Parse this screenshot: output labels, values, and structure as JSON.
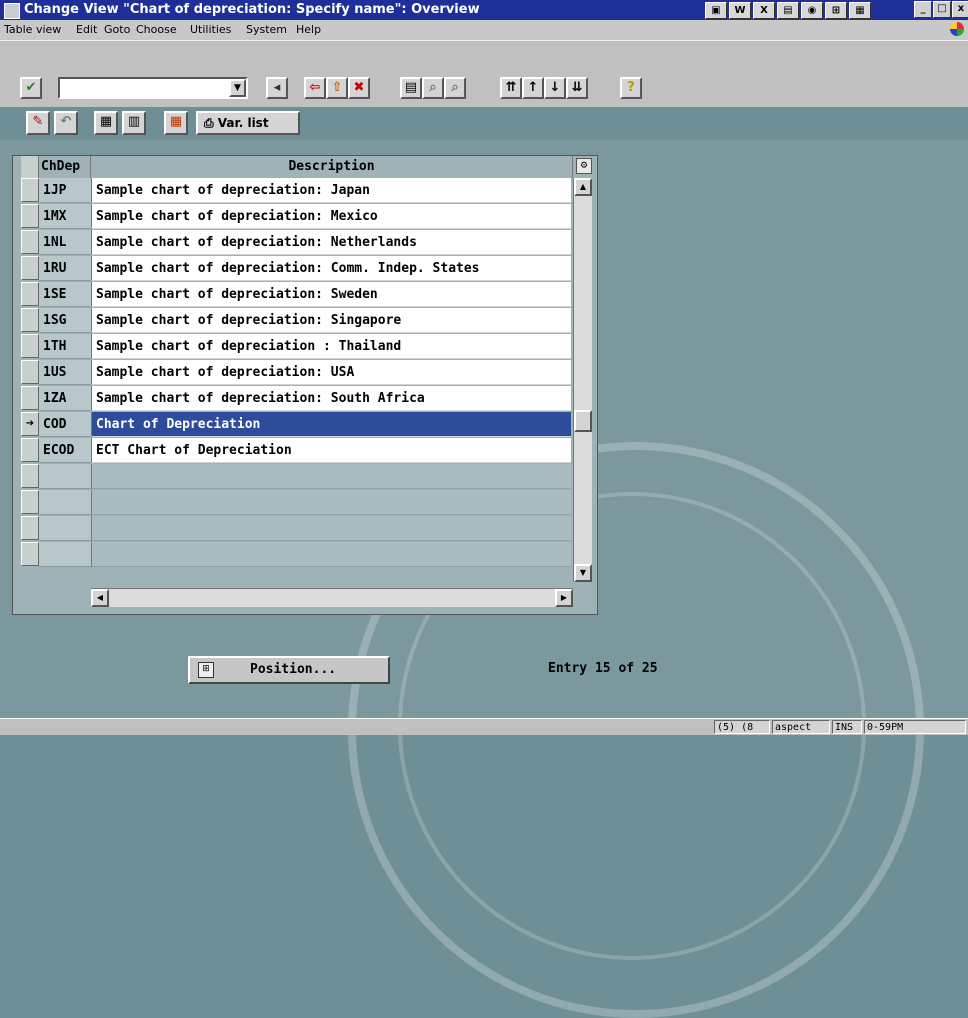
{
  "window": {
    "title": "Change View \"Chart of depreciation: Specify name\": Overview",
    "controls": [
      "_",
      "□",
      "x"
    ]
  },
  "title_tools": [
    "▣",
    "W",
    "X",
    "▤",
    "◉",
    "⊞",
    "▦"
  ],
  "menu": [
    {
      "label": "Table view"
    },
    {
      "label": "Edit"
    },
    {
      "label": "Goto"
    },
    {
      "label": "Choose"
    },
    {
      "label": "Utilities"
    },
    {
      "label": "System"
    },
    {
      "label": "Help"
    }
  ],
  "toolbar": {
    "command_field_value": "",
    "var_list_label": "Var. list",
    "help_label": "?"
  },
  "table": {
    "columns": [
      "ChDep",
      "Description"
    ],
    "rows": [
      {
        "key": "1JP",
        "desc": "Sample chart of depreciation: Japan"
      },
      {
        "key": "1MX",
        "desc": "Sample chart of depreciation: Mexico"
      },
      {
        "key": "1NL",
        "desc": "Sample chart of depreciation: Netherlands"
      },
      {
        "key": "1RU",
        "desc": "Sample chart of depreciation: Comm. Indep. States"
      },
      {
        "key": "1SE",
        "desc": "Sample chart of depreciation: Sweden"
      },
      {
        "key": "1SG",
        "desc": "Sample chart of depreciation: Singapore"
      },
      {
        "key": "1TH",
        "desc": "Sample chart of depreciation : Thailand"
      },
      {
        "key": "1US",
        "desc": "Sample chart of depreciation: USA"
      },
      {
        "key": "1ZA",
        "desc": "Sample chart of depreciation: South Africa"
      },
      {
        "key": "COD",
        "desc": "Chart of Depreciation",
        "selected": true
      },
      {
        "key": "ECOD",
        "desc": "ECT Chart of Depreciation"
      }
    ]
  },
  "position_button_label": "Position...",
  "entry_info": "Entry 15 of 25",
  "status": {
    "fields": [
      "(5) (8",
      "aspect",
      "INS",
      "0-59PM"
    ]
  },
  "colors": {
    "title_bar": "#1f2f9a",
    "selection": "#2f4c9b",
    "background": "#7b989e"
  }
}
